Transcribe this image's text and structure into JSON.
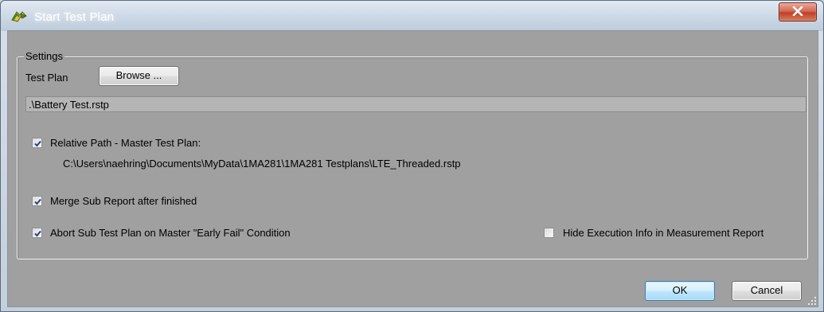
{
  "window": {
    "title": "Start Test Plan",
    "icon": "start-test-plan-arrow-icon"
  },
  "settings": {
    "group_label": "Settings",
    "test_plan_label": "Test Plan",
    "browse_label": "Browse ...",
    "test_plan_path": ".\\Battery Test.rstp",
    "relative_path": {
      "label": "Relative Path - Master Test Plan:",
      "checked": true,
      "master_path": "C:\\Users\\naehring\\Documents\\MyData\\1MA281\\1MA281 Testplans\\LTE_Threaded.rstp"
    },
    "merge_sub_report": {
      "label": "Merge Sub Report after finished",
      "checked": true
    },
    "abort_sub_test_plan": {
      "label": "Abort Sub Test Plan on Master \"Early Fail\" Condition",
      "checked": true
    },
    "hide_execution_info": {
      "label": "Hide Execution Info in Measurement Report",
      "checked": false
    }
  },
  "buttons": {
    "ok_label": "OK",
    "cancel_label": "Cancel"
  },
  "colors": {
    "client_background": "#a0a0a0",
    "title_text": "#ffffff",
    "close_button": "#c23f25",
    "default_button_border": "#3c7fb1"
  }
}
